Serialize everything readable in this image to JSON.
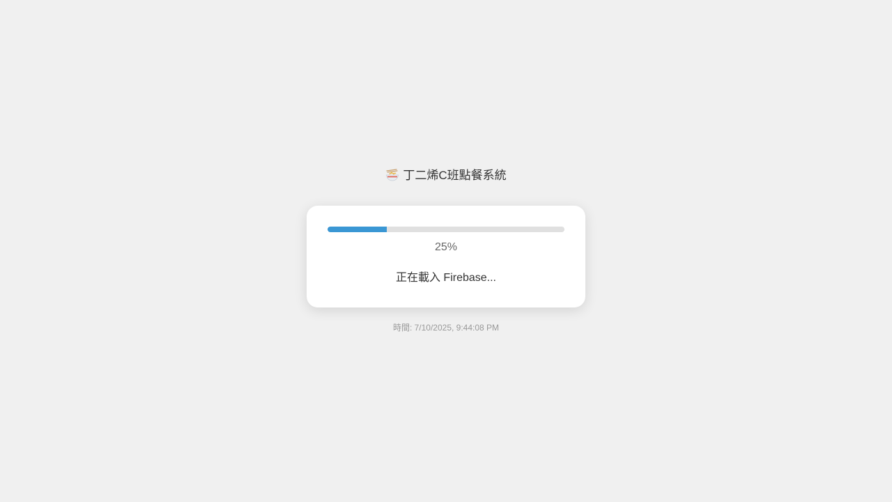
{
  "title": {
    "icon": "noodle-bowl-icon",
    "text": "丁二烯C班點餐系統"
  },
  "loader": {
    "progress_percent": 25,
    "percent_label": "25%",
    "status_text": "正在載入 Firebase...",
    "bar_color": "#3a97d4",
    "track_color": "#e0e0e0"
  },
  "footer": {
    "timestamp_text": "時間: 7/10/2025, 9:44:08 PM"
  }
}
